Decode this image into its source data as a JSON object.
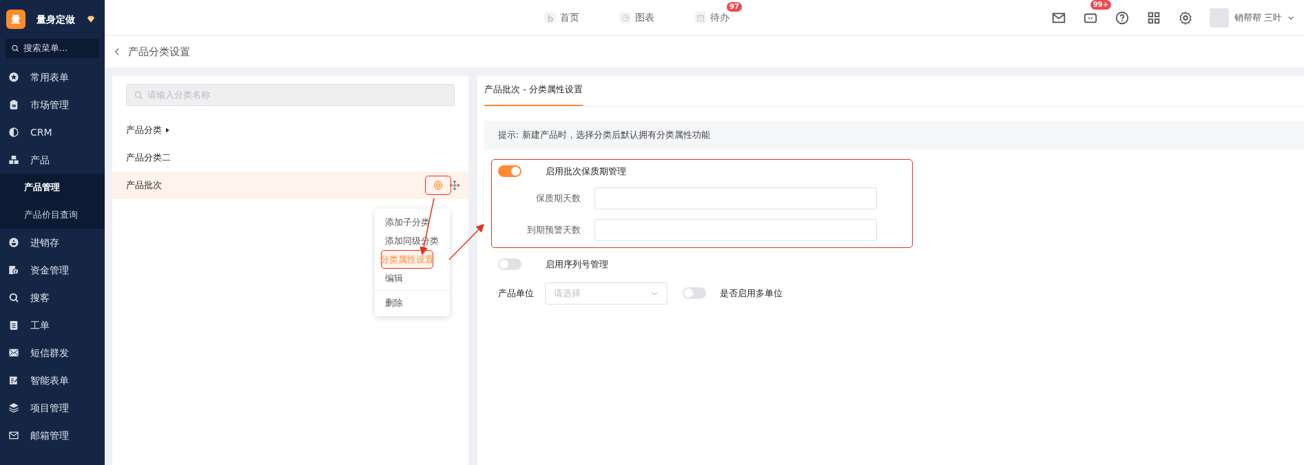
{
  "sidebar": {
    "logo_text": "量",
    "brand": "量身定做",
    "search_placeholder": "搜索菜单...",
    "items": [
      {
        "label": "常用表单"
      },
      {
        "label": "市场管理"
      },
      {
        "label": "CRM"
      },
      {
        "label": "产品",
        "children": [
          {
            "label": "产品管理",
            "selected": true
          },
          {
            "label": "产品价目查询",
            "selected": false
          }
        ]
      },
      {
        "label": "进销存"
      },
      {
        "label": "资金管理"
      },
      {
        "label": "搜客"
      },
      {
        "label": "工单"
      },
      {
        "label": "短信群发"
      },
      {
        "label": "智能表单"
      },
      {
        "label": "项目管理"
      },
      {
        "label": "邮箱管理"
      }
    ]
  },
  "topbar": {
    "nav": [
      {
        "label": "首页"
      },
      {
        "label": "图表"
      },
      {
        "label": "待办",
        "badge": "97"
      }
    ],
    "message_badge": "99+",
    "user_name": "销帮帮 三叶"
  },
  "breadcrumb": {
    "title": "产品分类设置"
  },
  "category_panel": {
    "search_placeholder": "请输入分类名称",
    "categories": [
      {
        "label": "产品分类",
        "has_children": true,
        "selected": false
      },
      {
        "label": "产品分类二",
        "has_children": false,
        "selected": false
      },
      {
        "label": "产品批次",
        "has_children": false,
        "selected": true
      }
    ],
    "context_menu": [
      {
        "label": "添加子分类",
        "selected": false
      },
      {
        "label": "添加同级分类",
        "selected": false
      },
      {
        "label": "分类属性设置",
        "selected": true
      },
      {
        "label": "编辑",
        "selected": false
      },
      {
        "label": "删除",
        "selected": false
      }
    ]
  },
  "settings": {
    "tabs": [
      {
        "label": "产品批次 - 分类属性设置",
        "selected": true
      }
    ],
    "tip": "提示: 新建产品时，选择分类后默认拥有分类属性功能",
    "shelf_life": {
      "label": "启用批次保质期管理",
      "on": true,
      "fields": [
        {
          "label": "保质期天数"
        },
        {
          "label": "到期预警天数"
        }
      ]
    },
    "serial": {
      "label": "启用序列号管理",
      "on": false
    },
    "unit": {
      "label": "产品单位",
      "placeholder": "请选择",
      "multi_unit": {
        "label": "是否启用多单位",
        "on": false
      }
    }
  }
}
